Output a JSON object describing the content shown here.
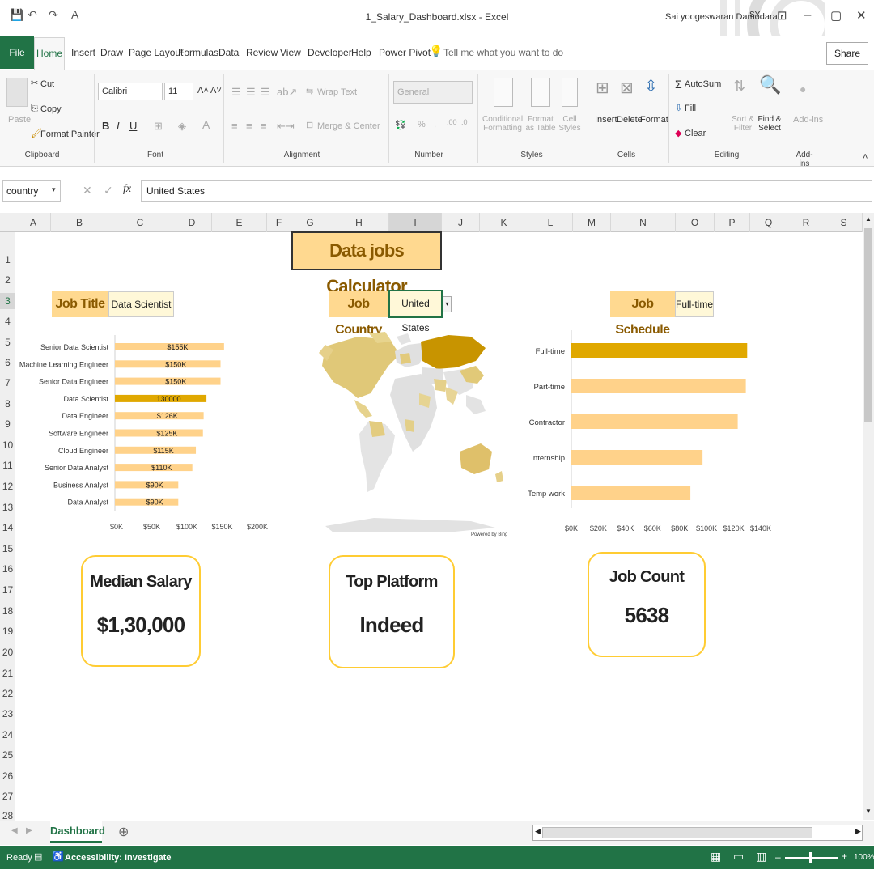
{
  "window": {
    "title": "1_Salary_Dashboard.xlsx  -  Excel",
    "user": "Sai yoogeswaran Damodaran",
    "initials": "SY"
  },
  "menu": {
    "file": "File",
    "tabs": [
      "Home",
      "Insert",
      "Draw",
      "Page Layout",
      "Formulas",
      "Data",
      "Review",
      "View",
      "Developer",
      "Help",
      "Power Pivot"
    ],
    "tell_me": "Tell me what you want to do",
    "share": "Share"
  },
  "ribbon": {
    "clipboard": {
      "paste": "Paste",
      "cut": "Cut",
      "copy": "Copy",
      "format_painter": "Format Painter",
      "group": "Clipboard"
    },
    "font": {
      "name": "Calibri",
      "size": "11",
      "group": "Font"
    },
    "alignment": {
      "wrap": "Wrap Text",
      "merge": "Merge & Center",
      "group": "Alignment"
    },
    "number": {
      "format": "General",
      "group": "Number"
    },
    "styles": {
      "conditional": "Conditional Formatting",
      "format_table": "Format as Table",
      "cell_styles": "Cell Styles",
      "group": "Styles"
    },
    "cells": {
      "insert": "Insert",
      "delete": "Delete",
      "format": "Format",
      "group": "Cells"
    },
    "editing": {
      "autosum": "AutoSum",
      "fill": "Fill",
      "clear": "Clear",
      "sort": "Sort & Filter",
      "find": "Find & Select",
      "group": "Editing"
    },
    "addins": {
      "label": "Add-ins",
      "group": "Add-ins"
    }
  },
  "formula_bar": {
    "name_box": "country",
    "value": "United States"
  },
  "columns": [
    "A",
    "B",
    "C",
    "D",
    "E",
    "F",
    "G",
    "H",
    "I",
    "J",
    "K",
    "L",
    "M",
    "N",
    "O",
    "P",
    "Q",
    "R",
    "S"
  ],
  "rows": [
    "1",
    "2",
    "3",
    "4",
    "5",
    "6",
    "7",
    "8",
    "9",
    "10",
    "11",
    "12",
    "13",
    "14",
    "15",
    "16",
    "17",
    "18",
    "19",
    "20",
    "21",
    "22",
    "23",
    "24",
    "25",
    "26",
    "27",
    "28"
  ],
  "dashboard": {
    "title": "Data jobs Calculator",
    "job_title_label": "Job Title",
    "job_title_value": "Data Scientist",
    "job_country_label": "Job Country",
    "job_country_value": "United States",
    "job_schedule_label": "Job Schedule",
    "job_schedule_value": "Full-time",
    "map_credit": "Powered by Bing",
    "cards": [
      {
        "title": "Median Salary",
        "value": "$1,30,000"
      },
      {
        "title": "Top Platform",
        "value": "Indeed"
      },
      {
        "title": "Job Count",
        "value": "5638"
      }
    ]
  },
  "chart_data": [
    {
      "type": "bar",
      "orientation": "horizontal",
      "categories": [
        "Senior Data Scientist",
        "Machine Learning Engineer",
        "Senior Data Engineer",
        "Data Scientist",
        "Data Engineer",
        "Software Engineer",
        "Cloud Engineer",
        "Senior Data Analyst",
        "Business Analyst",
        "Data Analyst"
      ],
      "values": [
        155000,
        150000,
        150000,
        130000,
        126000,
        125000,
        115000,
        110000,
        90000,
        90000
      ],
      "data_labels": [
        "$155K",
        "$150K",
        "$150K",
        "130000",
        "$126K",
        "$125K",
        "$115K",
        "$110K",
        "$90K",
        "$90K"
      ],
      "highlight": "Data Scientist",
      "xticks": [
        "$0K",
        "$50K",
        "$100K",
        "$150K",
        "$200K"
      ],
      "xlim": [
        0,
        200000
      ],
      "colors": {
        "bar": "#ffd28a",
        "highlight": "#e0a800"
      }
    },
    {
      "type": "bar",
      "orientation": "horizontal",
      "categories": [
        "Full-time",
        "Part-time",
        "Contractor",
        "Internship",
        "Temp work"
      ],
      "values": [
        130000,
        129000,
        123000,
        97000,
        88000
      ],
      "highlight": "Full-time",
      "xticks": [
        "$0K",
        "$20K",
        "$40K",
        "$60K",
        "$80K",
        "$100K",
        "$120K",
        "$140K"
      ],
      "xlim": [
        0,
        140000
      ],
      "colors": {
        "bar": "#ffd28a",
        "highlight": "#e0a800"
      }
    }
  ],
  "sheet": {
    "tab": "Dashboard"
  },
  "status": {
    "ready": "Ready",
    "accessibility": "Accessibility: Investigate",
    "zoom": "100%"
  }
}
